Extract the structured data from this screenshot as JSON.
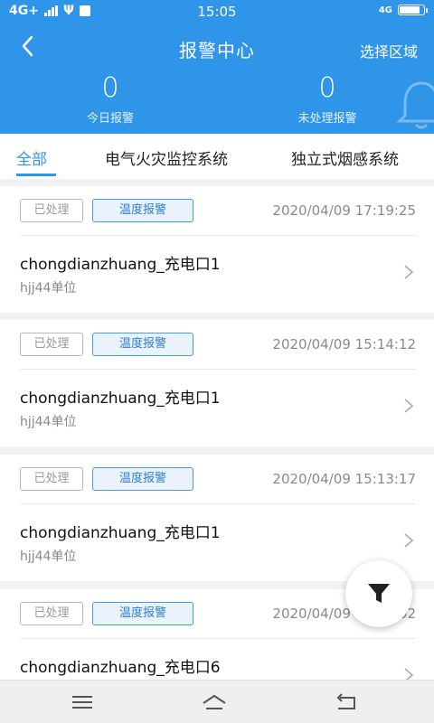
{
  "status_bar": {
    "network": "4G+",
    "time": "15:05",
    "right_network": "4G"
  },
  "header": {
    "title": "报警中心",
    "select_area": "选择区域",
    "today_alarms": {
      "value": "0",
      "label": "今日报警"
    },
    "pending_alarms": {
      "value": "0",
      "label": "未处理报警"
    }
  },
  "tabs": [
    "全部",
    "电气火灾监控系统",
    "独立式烟感系统"
  ],
  "alarms": [
    {
      "status": "已处理",
      "type": "温度报警",
      "time": "2020/04/09 17:19:25",
      "name": "chongdianzhuang_充电口1",
      "unit": "hjj44单位"
    },
    {
      "status": "已处理",
      "type": "温度报警",
      "time": "2020/04/09 15:14:12",
      "name": "chongdianzhuang_充电口1",
      "unit": "hjj44单位"
    },
    {
      "status": "已处理",
      "type": "温度报警",
      "time": "2020/04/09 15:13:17",
      "name": "chongdianzhuang_充电口1",
      "unit": "hjj44单位"
    },
    {
      "status": "已处理",
      "type": "温度报警",
      "time": "2020/04/09 15:13:02",
      "name": "chongdianzhuang_充电口6",
      "unit": ""
    }
  ],
  "colors": {
    "primary": "#2f95e8",
    "badge_done": "#9a9a9a",
    "badge_temp": "#2f7fd0"
  },
  "icons": {
    "back": "back-arrow-icon",
    "bell": "bell-icon",
    "filter": "filter-icon",
    "chevron": "chevron-right-icon"
  }
}
